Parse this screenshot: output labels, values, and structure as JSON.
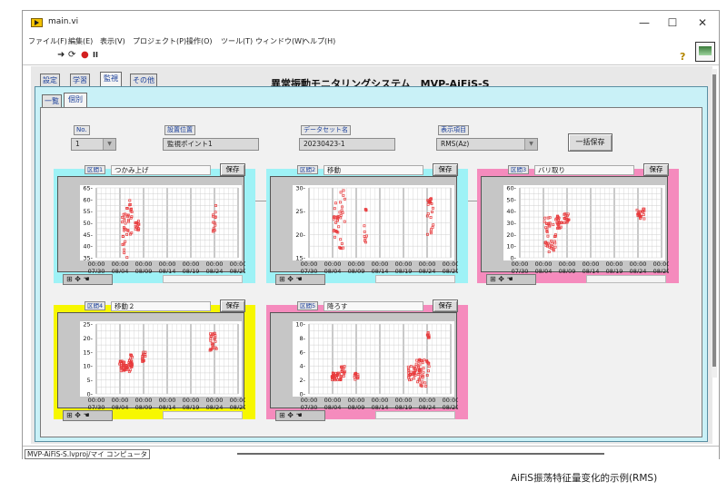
{
  "window": {
    "title": "main.vi",
    "minimize": "—",
    "maximize": "☐",
    "close": "✕"
  },
  "menu": [
    "ファイル(F)",
    "編集(E)",
    "表示(V)",
    "プロジェクト(P)",
    "操作(O)",
    "ツール(T)",
    "ウィンドウ(W)",
    "ヘルプ(H)"
  ],
  "toolbar": {
    "run": "➜",
    "run_cont": "⟳",
    "abort": "●",
    "pause": "II",
    "help": "?"
  },
  "tabs": [
    "設定",
    "学習",
    "監視",
    "その他"
  ],
  "active_tab": 2,
  "main_title": "異常振動モニタリングシステム　MVP-AiFiS-S",
  "subtabs": [
    "一覧",
    "個別"
  ],
  "active_subtab": 1,
  "controls": {
    "no_label": "No.",
    "no_value": "1",
    "location_label": "設置位置",
    "location_value": "監視ポイント1",
    "dataset_label": "データセット名",
    "dataset_value": "20230423-1",
    "display_label": "表示項目",
    "display_value": "RMS(Az)",
    "save_all": "一括保存"
  },
  "save_label": "保存",
  "tools_label": "⊞ ✥ ☚",
  "status": {
    "path": "MVP-AiFiS-S.lvproj/マイ コンピュータ"
  },
  "caption": "AiFiS振荡特征量变化的示例(RMS)",
  "colors": {
    "cyan": "#9ef2f6",
    "pink": "#f58bbd",
    "yellow": "#f7f700",
    "points": "#e8393b"
  },
  "charts": [
    {
      "label": "区間1",
      "name": "つかみ上げ",
      "color": "cyan"
    },
    {
      "label": "区間2",
      "name": "移動",
      "color": "cyan"
    },
    {
      "label": "区間3",
      "name": "バリ取り",
      "color": "pink"
    },
    {
      "label": "区間4",
      "name": "移動２",
      "color": "yellow"
    },
    {
      "label": "区間5",
      "name": "降ろす",
      "color": "pink"
    }
  ],
  "chart_data": [
    {
      "type": "scatter",
      "title": "つかみ上げ",
      "x_ticks": [
        "00:00\n07/30",
        "00:00\n08/04",
        "00:00\n08/09",
        "00:00\n08/14",
        "00:00\n08/19",
        "00:00\n08/24",
        "00:00\n08/29"
      ],
      "ylim": [
        35,
        65
      ],
      "y_ticks": [
        35,
        40,
        45,
        50,
        55,
        60,
        65
      ],
      "clusters": [
        {
          "x_range": [
            5.4,
            6.0
          ],
          "y_range": [
            40,
            54
          ]
        },
        {
          "x_range": [
            5.8,
            6.5
          ],
          "y_range": [
            35,
            59
          ]
        },
        {
          "x_range": [
            6.4,
            7.6
          ],
          "y_range": [
            45,
            61
          ]
        },
        {
          "x_range": [
            8.2,
            9.0
          ],
          "y_range": [
            47,
            51
          ]
        },
        {
          "x_range": [
            24.6,
            25.4
          ],
          "y_range": [
            46,
            58
          ]
        }
      ]
    },
    {
      "type": "scatter",
      "title": "移動",
      "x_ticks": [
        "00:00\n07/30",
        "00:00\n08/04",
        "00:00\n08/09",
        "00:00\n08/14",
        "00:00\n08/19",
        "00:00\n08/24",
        "00:00\n08/29"
      ],
      "ylim": [
        15,
        30
      ],
      "y_ticks": [
        15,
        20,
        25,
        30
      ],
      "clusters": [
        {
          "x_range": [
            5.2,
            6.6
          ],
          "y_range": [
            17,
            27
          ]
        },
        {
          "x_range": [
            6.6,
            7.6
          ],
          "y_range": [
            17,
            30
          ]
        },
        {
          "x_range": [
            11.6,
            12.2
          ],
          "y_range": [
            18,
            26
          ]
        },
        {
          "x_range": [
            25.0,
            26.4
          ],
          "y_range": [
            20,
            28
          ]
        }
      ]
    },
    {
      "type": "scatter",
      "title": "バリ取り",
      "x_ticks": [
        "00:00\n07/30",
        "00:00\n08/04",
        "00:00\n08/09",
        "00:00\n08/14",
        "00:00\n08/19",
        "00:00\n08/24",
        "00:00\n08/29"
      ],
      "ylim": [
        0,
        60
      ],
      "y_ticks": [
        0,
        10,
        20,
        30,
        40,
        50,
        60
      ],
      "clusters": [
        {
          "x_range": [
            5.2,
            7.6
          ],
          "y_range": [
            5,
            35
          ]
        },
        {
          "x_range": [
            7.8,
            9.0
          ],
          "y_range": [
            25,
            36
          ]
        },
        {
          "x_range": [
            9.4,
            10.4
          ],
          "y_range": [
            30,
            38
          ]
        },
        {
          "x_range": [
            24.8,
            26.4
          ],
          "y_range": [
            33,
            42
          ]
        }
      ]
    },
    {
      "type": "scatter",
      "title": "移動２",
      "x_ticks": [
        "00:00\n07/30",
        "00:00\n08/04",
        "00:00\n08/09",
        "00:00\n08/14",
        "00:00\n08/19",
        "00:00\n08/24",
        "00:00\n08/29"
      ],
      "ylim": [
        0,
        25
      ],
      "y_ticks": [
        0,
        5,
        10,
        15,
        20,
        25
      ],
      "clusters": [
        {
          "x_range": [
            4.8,
            7.6
          ],
          "y_range": [
            8,
            12
          ]
        },
        {
          "x_range": [
            6.8,
            7.6
          ],
          "y_range": [
            10,
            14
          ]
        },
        {
          "x_range": [
            9.6,
            10.4
          ],
          "y_range": [
            11,
            15
          ]
        },
        {
          "x_range": [
            24.0,
            25.4
          ],
          "y_range": [
            15,
            22
          ]
        }
      ]
    },
    {
      "type": "scatter",
      "title": "降ろす",
      "x_ticks": [
        "00:00\n07/30",
        "00:00\n08/04",
        "00:00\n08/09",
        "00:00\n08/14",
        "00:00\n08/19",
        "00:00\n08/24",
        "00:00\n08/29"
      ],
      "ylim": [
        0,
        10
      ],
      "y_ticks": [
        0,
        2,
        4,
        6,
        8,
        10
      ],
      "clusters": [
        {
          "x_range": [
            4.8,
            6.4
          ],
          "y_range": [
            2,
            3
          ]
        },
        {
          "x_range": [
            6.4,
            7.6
          ],
          "y_range": [
            2,
            4
          ]
        },
        {
          "x_range": [
            9.6,
            10.4
          ],
          "y_range": [
            2,
            3
          ]
        },
        {
          "x_range": [
            21.0,
            22.6
          ],
          "y_range": [
            2,
            4
          ]
        },
        {
          "x_range": [
            22.6,
            25.4
          ],
          "y_range": [
            1,
            5
          ]
        },
        {
          "x_range": [
            25.0,
            25.4
          ],
          "y_range": [
            8,
            9
          ]
        }
      ]
    }
  ]
}
